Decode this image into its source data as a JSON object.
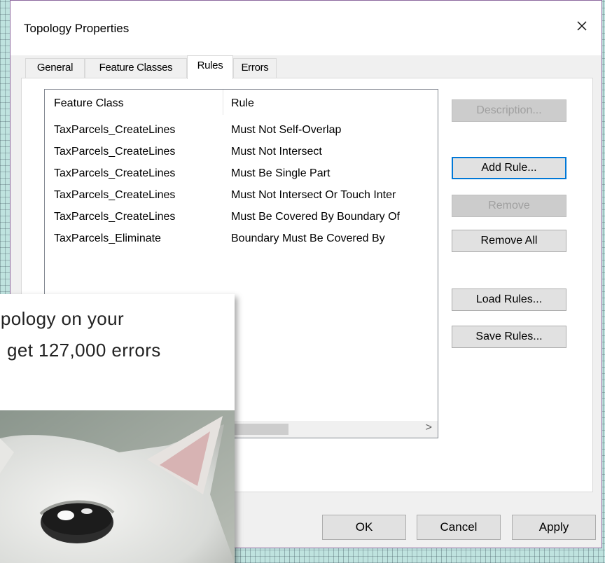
{
  "dialog": {
    "title": "Topology Properties",
    "close_label": "×"
  },
  "tabs": [
    {
      "label": "General"
    },
    {
      "label": "Feature Classes"
    },
    {
      "label": "Rules"
    },
    {
      "label": "Errors"
    }
  ],
  "active_tab": "Rules",
  "rules_table": {
    "headers": [
      "Feature Class",
      "Rule"
    ],
    "rows": [
      {
        "feature_class": "TaxParcels_CreateLines",
        "rule": "Must Not Self-Overlap"
      },
      {
        "feature_class": "TaxParcels_CreateLines",
        "rule": "Must Not Intersect"
      },
      {
        "feature_class": "TaxParcels_CreateLines",
        "rule": "Must Be Single Part"
      },
      {
        "feature_class": "TaxParcels_CreateLines",
        "rule": "Must Not Intersect Or Touch Inter"
      },
      {
        "feature_class": "TaxParcels_CreateLines",
        "rule": "Must Be Covered By Boundary Of"
      },
      {
        "feature_class": "TaxParcels_Eliminate",
        "rule": "Boundary Must Be Covered By"
      }
    ],
    "scroll_right_icon": ">"
  },
  "side_buttons": {
    "description": "Description...",
    "add_rule": "Add Rule...",
    "remove": "Remove",
    "remove_all": "Remove All",
    "load_rules": "Load Rules...",
    "save_rules": "Save Rules..."
  },
  "footer_buttons": {
    "ok": "OK",
    "cancel": "Cancel",
    "apply": "Apply"
  },
  "meme": {
    "line1": "opology on your",
    "line2": "get 127,000 errors"
  },
  "icons": {
    "close": "close-icon",
    "scroll_right": "chevron-right-icon"
  },
  "colors": {
    "focus_border": "#0078d7",
    "dialog_border": "#8e6aa0"
  }
}
